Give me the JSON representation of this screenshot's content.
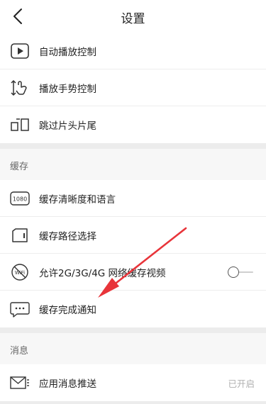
{
  "header": {
    "title": "设置"
  },
  "items_top": [
    {
      "label": "自动播放控制",
      "icon": "play-box-icon"
    },
    {
      "label": "播放手势控制",
      "icon": "gesture-icon"
    },
    {
      "label": "跳过片头片尾",
      "icon": "skip-intro-icon"
    }
  ],
  "sections": {
    "cache": {
      "title": "缓存"
    },
    "message": {
      "title": "消息"
    }
  },
  "cache_items": [
    {
      "label": "缓存清晰度和语言",
      "icon": "resolution-1080-icon"
    },
    {
      "label": "缓存路径选择",
      "icon": "sd-card-icon"
    },
    {
      "label": "允许2G/3G/4G 网络缓存视频",
      "icon": "wifi-off-icon",
      "toggle": "off"
    },
    {
      "label": "缓存完成通知",
      "icon": "chat-bubble-icon"
    }
  ],
  "message_items": [
    {
      "label": "应用消息推送",
      "value": "已开启",
      "icon": "mail-icon"
    }
  ],
  "colors": {
    "annotation_arrow": "#e8343a"
  }
}
